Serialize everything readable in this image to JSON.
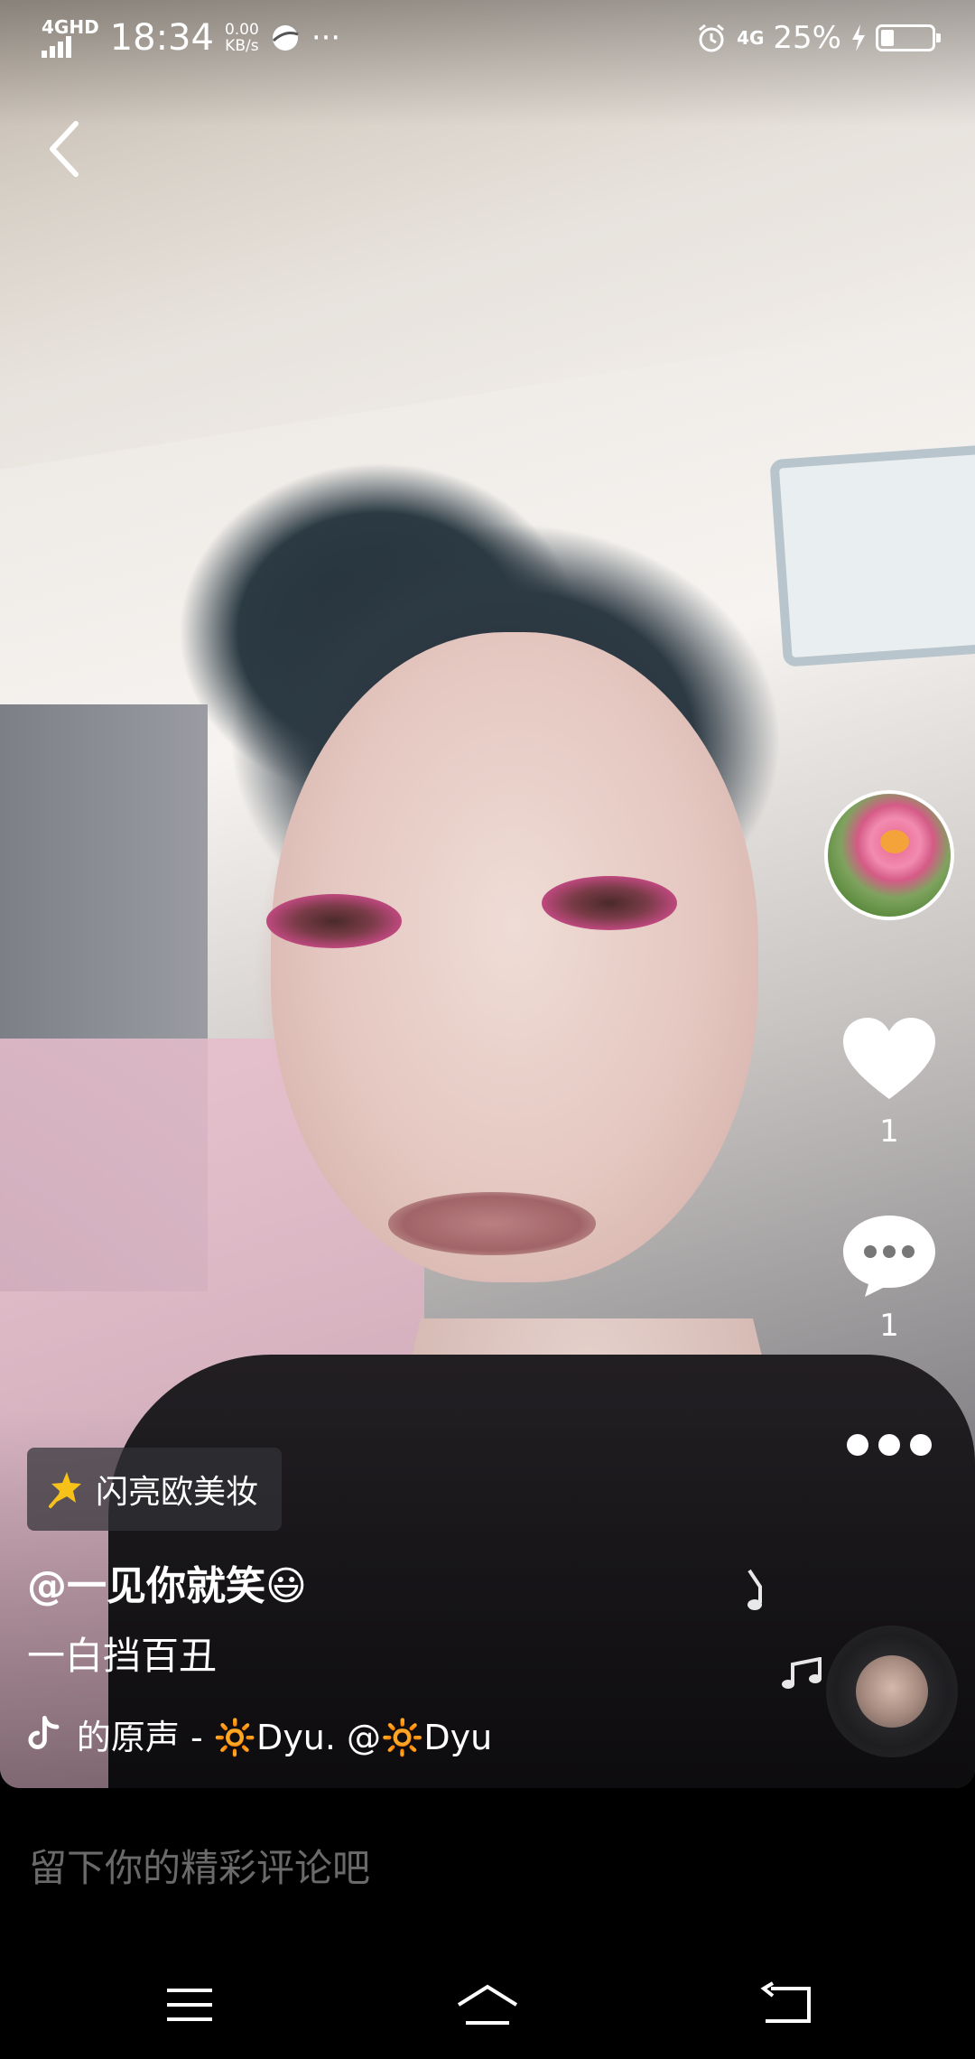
{
  "status_bar": {
    "network": "4GHD",
    "time": "18:34",
    "speed_value": "0.00",
    "speed_unit": "KB/s",
    "more": "···",
    "mobile": "4G",
    "battery_percent": "25%",
    "battery_level": 0.25
  },
  "video": {
    "effect_label": "闪亮欧美妆",
    "username": "@一见你就笑😃",
    "caption": "一白挡百丑",
    "music": "的原声 - 🔆Dyu.    @🔆Dyu"
  },
  "actions": {
    "like_count": "1",
    "comment_count": "1"
  },
  "comment_bar": {
    "placeholder": "留下你的精彩评论吧"
  },
  "colors": {
    "background": "#000000",
    "text": "#ffffff",
    "placeholder": "#6a6a6a"
  }
}
